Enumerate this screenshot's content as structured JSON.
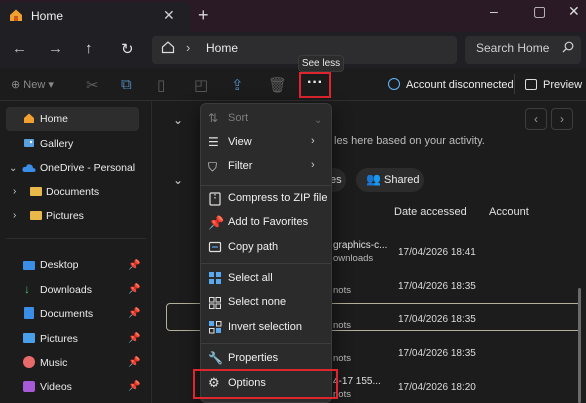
{
  "titlebar": {
    "tab_title": "Home",
    "new_tab": "+",
    "window_buttons": [
      "–",
      "▢",
      "✕"
    ]
  },
  "addressbar": {
    "location": "Home",
    "search_placeholder": "Search Home"
  },
  "commandbar": {
    "new_label": "New",
    "more_label": "···",
    "tooltip": "See less",
    "account_status": "Account disconnected",
    "preview_label": "Preview"
  },
  "sidebar": {
    "items": [
      {
        "label": "Home"
      },
      {
        "label": "Gallery"
      },
      {
        "label": "OneDrive - Personal"
      },
      {
        "label": "Documents"
      },
      {
        "label": "Pictures"
      },
      {
        "label": "Desktop"
      },
      {
        "label": "Downloads"
      },
      {
        "label": "Documents"
      },
      {
        "label": "Pictures"
      },
      {
        "label": "Music"
      },
      {
        "label": "Videos"
      }
    ]
  },
  "main": {
    "suggest_text": "les here based on your activity.",
    "pill_partial": "es",
    "shared_label": "Shared",
    "columns": {
      "date_accessed": "Date accessed",
      "account": "Account"
    },
    "rows": [
      {
        "name_partial": "graphics-c...",
        "location_partial": "ownloads",
        "date": "17/04/2026 18:41"
      },
      {
        "name_partial": "",
        "location_partial": "nots",
        "date": "17/04/2026 18:35"
      },
      {
        "name_partial": "",
        "location_partial": "nots",
        "date": "17/04/2026 18:35"
      },
      {
        "name_partial": "",
        "location_partial": "nots",
        "date": "17/04/2026 18:35"
      },
      {
        "name_partial": "4-17 155...",
        "location_partial": "nots",
        "date": "17/04/2026 18:20"
      }
    ]
  },
  "menu": {
    "sort": "Sort",
    "view": "View",
    "filter": "Filter",
    "compress": "Compress to ZIP file",
    "favorites": "Add to Favorites",
    "copy_path": "Copy path",
    "select_all": "Select all",
    "select_none": "Select none",
    "invert": "Invert selection",
    "properties": "Properties",
    "options": "Options"
  },
  "colors": {
    "accent_red": "#e0252f",
    "onedrive_blue": "#3a8ee6",
    "folder_yellow": "#e8b84a"
  }
}
